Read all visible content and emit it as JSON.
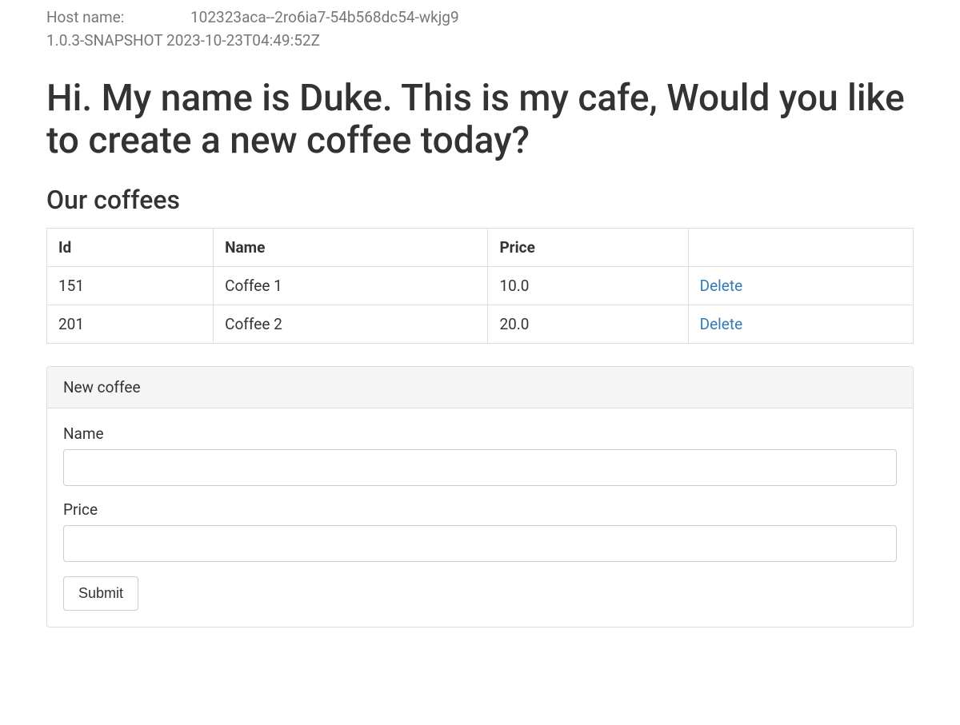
{
  "meta": {
    "hostname_label": "Host name:",
    "hostname_value": "102323aca--2ro6ia7-54b568dc54-wkjg9",
    "version": "1.0.3-SNAPSHOT",
    "build_time": "2023-10-23T04:49:52Z"
  },
  "heading": "Hi. My name is Duke. This is my cafe, Would you like to create a new coffee today?",
  "subheading": "Our coffees",
  "table": {
    "headers": {
      "id": "Id",
      "name": "Name",
      "price": "Price",
      "actions": ""
    },
    "rows": [
      {
        "id": "151",
        "name": "Coffee 1",
        "price": "10.0",
        "action": "Delete"
      },
      {
        "id": "201",
        "name": "Coffee 2",
        "price": "20.0",
        "action": "Delete"
      }
    ]
  },
  "form": {
    "panel_title": "New coffee",
    "name_label": "Name",
    "name_value": "",
    "price_label": "Price",
    "price_value": "",
    "submit_label": "Submit"
  }
}
